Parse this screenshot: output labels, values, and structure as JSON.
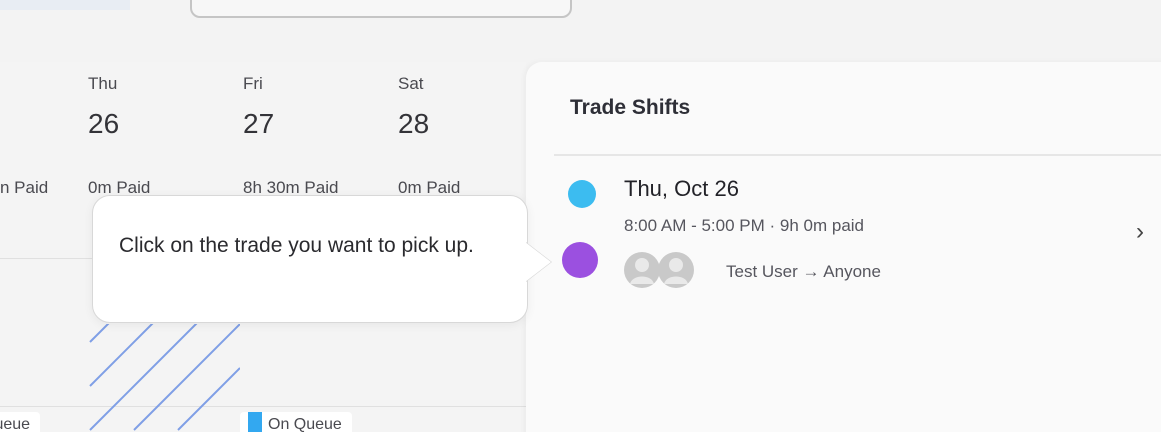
{
  "schedule": {
    "days": [
      {
        "name": "Thu",
        "date": "26"
      },
      {
        "name": "Fri",
        "date": "27"
      },
      {
        "name": "Sat",
        "date": "28"
      }
    ],
    "paid": [
      "n Paid",
      "0m Paid",
      "8h 30m Paid",
      "0m Paid"
    ],
    "queue_labels": [
      "Queue",
      "On Queue"
    ]
  },
  "panel": {
    "title": "Trade Shifts",
    "trade": {
      "date_day": "Thu",
      "date_rest": ", Oct 26",
      "time": "8:00 AM - 5:00 PM · 9h 0m paid",
      "users": "Test User → Anyone"
    }
  },
  "tooltip": {
    "text": "Click on the trade you want to pick up."
  },
  "colors": {
    "dot_blue": "#3cbcf0",
    "dot_purple": "#9b50e0",
    "queue_blue": "#33a8f0"
  },
  "icons": {
    "chevron": "chevron-right-icon",
    "avatars": "user-avatar-group-icon"
  }
}
